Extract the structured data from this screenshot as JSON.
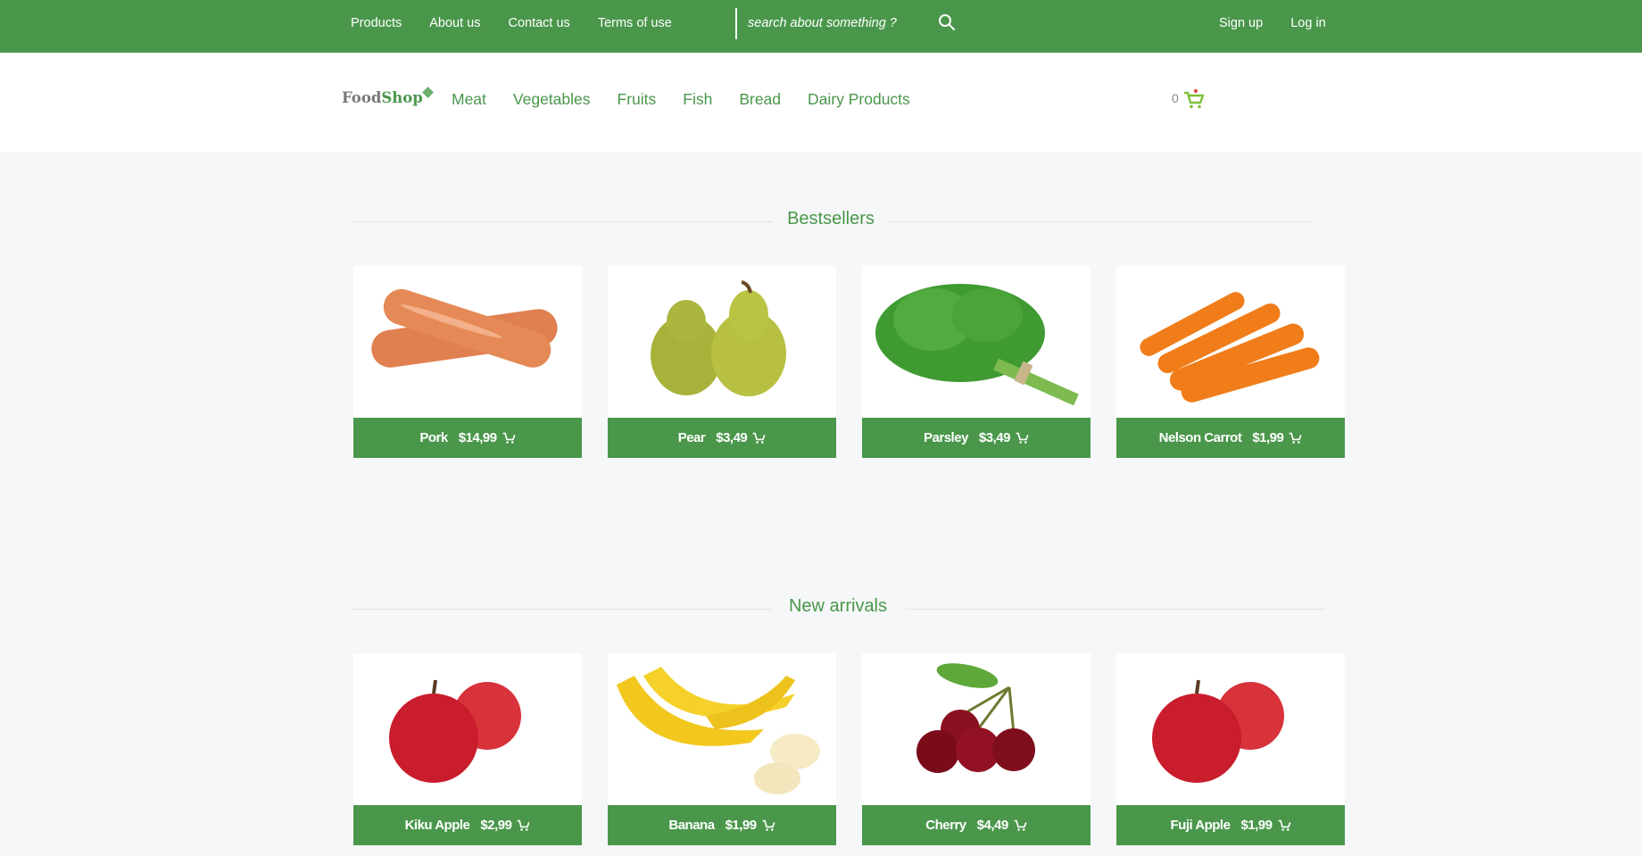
{
  "topbar": {
    "links": [
      "Products",
      "About us",
      "Contact us",
      "Terms of use"
    ],
    "search_placeholder": "search about something ?",
    "auth": [
      "Sign up",
      "Log in"
    ]
  },
  "header": {
    "logo_part1": "Food",
    "logo_part2": "Shop",
    "categories": [
      "Meat",
      "Vegetables",
      "Fruits",
      "Fish",
      "Bread",
      "Dairy Products"
    ],
    "cart_count": "0"
  },
  "bestsellers": {
    "title": "Bestsellers",
    "products": [
      {
        "name": "Pork",
        "price": "$14,99",
        "icon": "sausage"
      },
      {
        "name": "Pear",
        "price": "$3,49",
        "icon": "pear"
      },
      {
        "name": "Parsley",
        "price": "$3,49",
        "icon": "parsley"
      },
      {
        "name": "Nelson Carrot",
        "price": "$1,99",
        "icon": "carrot"
      }
    ]
  },
  "new_arrivals": {
    "title": "New arrivals",
    "products": [
      {
        "name": "Kiku Apple",
        "price": "$2,99",
        "icon": "apple"
      },
      {
        "name": "Banana",
        "price": "$1,99",
        "icon": "banana"
      },
      {
        "name": "Cherry",
        "price": "$4,49",
        "icon": "cherry"
      },
      {
        "name": "Fuji Apple",
        "price": "$1,99",
        "icon": "apple"
      }
    ]
  },
  "colors": {
    "brand": "#4a974b",
    "background": "#f5f7f8",
    "cart_icon": "#7cc03a"
  }
}
